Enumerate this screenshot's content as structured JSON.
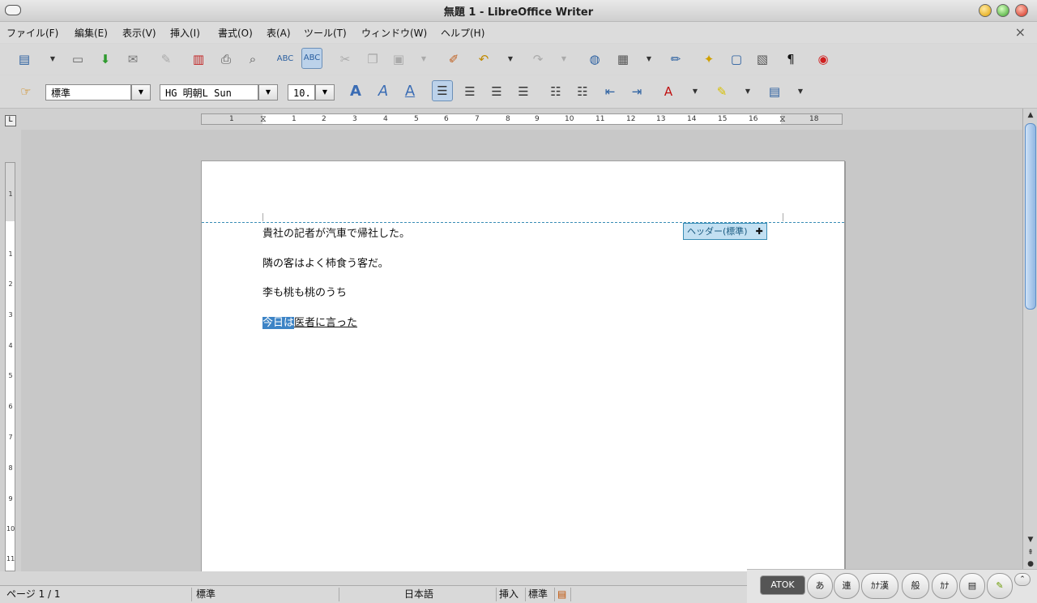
{
  "window": {
    "title": "無題 1 - LibreOffice Writer"
  },
  "menu": {
    "items": [
      "ファイル(F)",
      "編集(E)",
      "表示(V)",
      "挿入(I)",
      "書式(O)",
      "表(A)",
      "ツール(T)",
      "ウィンドウ(W)",
      "ヘルプ(H)"
    ],
    "close_icon": "×"
  },
  "formatting": {
    "paragraph_style": "標準",
    "font_name": "HG 明朝L Sun",
    "font_size": "10."
  },
  "ruler": {
    "h_ticks": [
      "1",
      "1",
      "2",
      "3",
      "4",
      "5",
      "6",
      "7",
      "8",
      "9",
      "10",
      "11",
      "12",
      "13",
      "14",
      "15",
      "16",
      "17",
      "18"
    ],
    "v_ticks": [
      "1",
      "1",
      "2",
      "3",
      "4",
      "5",
      "6",
      "7",
      "8",
      "9",
      "10",
      "11"
    ]
  },
  "document": {
    "lines": [
      "貴社の記者が汽車で帰社した。",
      "隣の客はよく柿食う客だ。",
      "李も桃も桃のうち"
    ],
    "last_line_selected": "今日は",
    "last_line_rest": "医者に言った",
    "header_tag": "ヘッダー(標準)",
    "header_tag_plus": "✚"
  },
  "status": {
    "page": "ページ 1 / 1",
    "page_style": "標準",
    "language": "日本語",
    "insert_mode": "挿入",
    "selection_mode": "標準"
  },
  "ime": {
    "buttons": [
      "ATOK",
      "あ",
      "連",
      "ｶﾅ漢",
      "般",
      "ｶﾅ"
    ]
  },
  "colors": {
    "selection": "#3d84c6",
    "header_border": "#3a8db5",
    "header_tag_bg": "#c3e0f2"
  }
}
